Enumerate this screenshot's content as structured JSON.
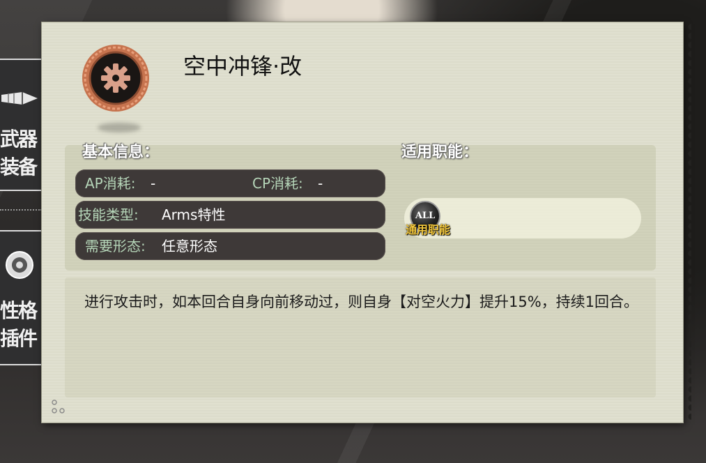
{
  "side_menu": {
    "top_label_1": "武器",
    "top_label_2": "装备",
    "bottom_label_1": "性格",
    "bottom_label_2": "插件"
  },
  "skill": {
    "name": "空中冲锋·改",
    "icon": "gear-icon"
  },
  "basic_info": {
    "heading": "基本信息：",
    "ap_label": "AP消耗:",
    "ap_value": "-",
    "cp_label": "CP消耗:",
    "cp_value": "-",
    "type_label": "技能类型:",
    "type_value": "Arms特性",
    "form_label": "需要形态:",
    "form_value": "任意形态"
  },
  "roles": {
    "heading": "适用职能：",
    "badge_text": "ALL",
    "badge_caption": "通用职能"
  },
  "description": "进行攻击时，如本回合自身向前移动过，则自身【对空火力】提升15%，持续1回合。",
  "colors": {
    "card_bg": "#dfdfce",
    "pill_bg": "#3e3938",
    "pill_key": "#b6d6b9",
    "badge_caption": "#f2c63b",
    "icon_ring": "#c6734e"
  }
}
